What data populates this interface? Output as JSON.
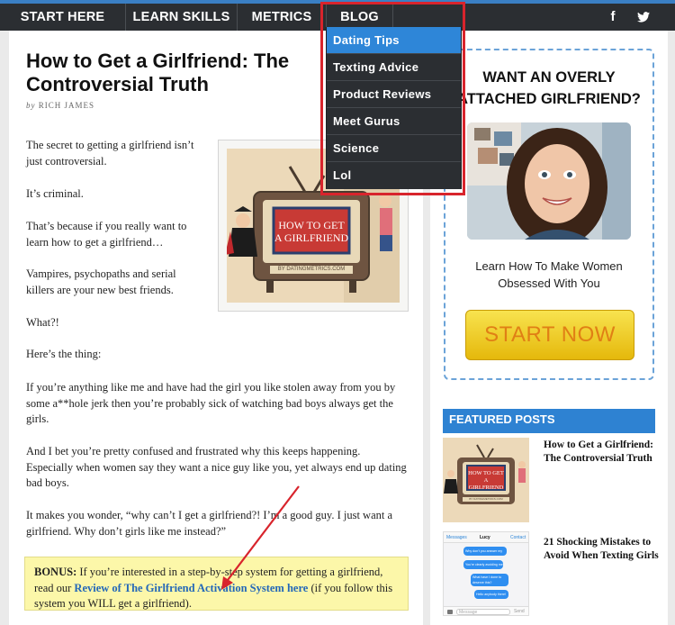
{
  "nav": {
    "items": [
      "START HERE",
      "LEARN SKILLS",
      "METRICS",
      "BLOG"
    ],
    "facebook_glyph": "f",
    "twitter_glyph": "twitter-icon"
  },
  "dropdown": {
    "items": [
      "Dating Tips",
      "Texting Advice",
      "Product Reviews",
      "Meet Gurus",
      "Science",
      "Lol"
    ],
    "active_index": 0
  },
  "article": {
    "title": "How to Get a Girlfriend: The Controversial Truth",
    "byline_prefix": "by",
    "author": "RICH JAMES",
    "paragraphs": [
      "The secret to getting a girlfriend isn’t just controversial.",
      "It’s criminal.",
      "That’s because if you really want to learn how to get a girlfriend…",
      "Vampires, psychopaths and serial killers are your new best friends.",
      "What?!",
      "Here’s the thing:",
      "If you’re anything like me and have had the girl you like stolen away from you by some a**hole jerk then you’re probably sick of watching bad boys always get the girls.",
      "And I bet you’re pretty confused and frustrated why this keeps happening. Especially when women say they want a nice guy like you, yet always end up dating bad boys.",
      "It makes you wonder, “why can’t I get a girlfriend?! I’m a good guy. I just want a girlfriend. Why don’t girls like me instead?”"
    ],
    "image": {
      "line1": "HOW TO GET",
      "line2": "A GIRLFRIEND",
      "credit": "BY DATINGMETRICS.COM"
    },
    "bonus": {
      "label": "BONUS:",
      "text_before": " If you’re interested in a step-by-step system for getting a girlfriend, read our ",
      "link": "Review of The Girlfriend Activation System here",
      "text_after": " (if you follow this system you WILL get a girlfriend)."
    }
  },
  "sidebar": {
    "promo": {
      "heading_line1": "WANT AN OVERLY",
      "heading_line2": "ATTACHED GIRLFRIEND?",
      "sub_line1": "Learn How To Make Women",
      "sub_line2": "Obsessed With You",
      "button": "START NOW"
    },
    "featured": {
      "heading": "FEATURED POSTS",
      "posts": [
        {
          "title": "How to Get a Girlfriend: The Controversial Truth",
          "thumb_line1": "HOW TO GET",
          "thumb_line2": "A GIRLFRIEND",
          "thumb_credit": "BY DATINGMETRICS.COM"
        },
        {
          "title": "21 Shocking Mistakes to Avoid When Texting Girls",
          "thumb_back": "Messages",
          "thumb_name": "Lucy",
          "thumb_contact": "Contact",
          "thumb_bubbles": [
            "Why don't you answer my call?",
            "You're clearly avoiding me",
            "What have I done to deserve this?",
            "Hello anybody there!"
          ],
          "thumb_input": "Message",
          "thumb_send": "Send"
        }
      ]
    }
  },
  "colors": {
    "nav_bg": "#2b2e32",
    "accent_blue": "#2e86d8",
    "highlight_red": "#d8242c",
    "bonus_bg": "#fcf7a9",
    "button_yellow": "#f2d02a",
    "button_text": "#e07f15"
  }
}
